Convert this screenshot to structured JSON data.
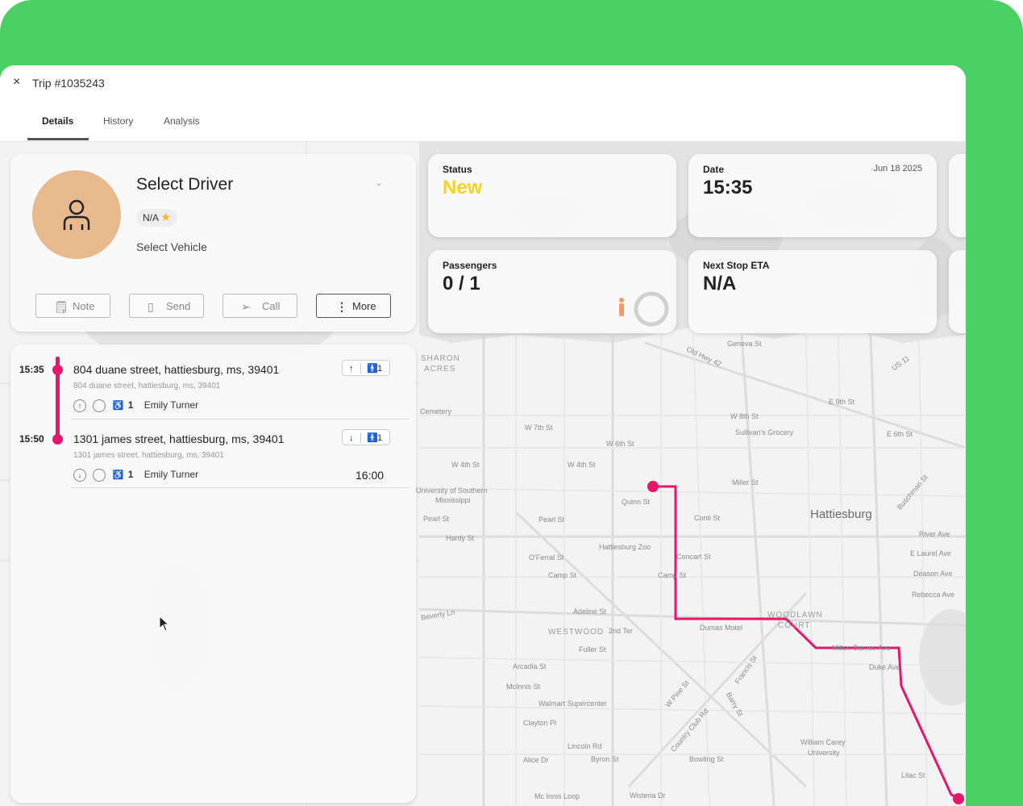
{
  "window": {
    "close_icon": "×",
    "title": "Trip #1035243"
  },
  "tabs": [
    {
      "label": "Details"
    },
    {
      "label": "History"
    },
    {
      "label": "Analysis"
    }
  ],
  "driver": {
    "name": "Select Driver",
    "rating": "N/A",
    "rating_star": "★",
    "vehicle": "Select Vehicle",
    "actions": {
      "note": "Note",
      "send": "Send",
      "call": "Call",
      "more": "More"
    }
  },
  "stats": {
    "status": {
      "title": "Status",
      "value": "New",
      "color": "#f5d320"
    },
    "date": {
      "title": "Date",
      "value": "15:35",
      "date": "Jun 18 2025"
    },
    "passengers": {
      "title": "Passengers",
      "value": "0 / 1"
    },
    "next_stop": {
      "title": "Next Stop ETA",
      "value": "N/A"
    }
  },
  "stops": [
    {
      "time": "15:35",
      "address": "804 duane street, hattiesburg, ms, 39401",
      "address_sub": "804 duane street, hattiesburg, ms, 39401",
      "direction": "↑",
      "count": "1",
      "passenger_count": "1",
      "passenger": "Emily Turner",
      "eta": ""
    },
    {
      "time": "15:50",
      "address": "1301 james street, hattiesburg, ms, 39401",
      "address_sub": "1301 james street, hattiesburg, ms, 39401",
      "direction": "↓",
      "count": "1",
      "passenger_count": "1",
      "passenger": "Emily Turner",
      "eta": "16:00"
    }
  ],
  "map": {
    "city": "Hattiesburg",
    "route_color": "#e5166c",
    "labels": {
      "l1": "SHARON",
      "l2": "ACRES",
      "l3": "Cemetery",
      "l4": "W 7th St",
      "l5": "W 4th St",
      "l6": "W 4th St",
      "l7": "W 6th St",
      "l8": "W 8th St",
      "l9": "Sullivan's Grocery",
      "l10": "Geneva St",
      "l11": "Old Hwy 42",
      "l12": "E 9th St",
      "l13": "E 6th St",
      "l14": "University of Southern",
      "l15": "Mississippi",
      "l16": "Pearl St",
      "l17": "Pearl St",
      "l18": "Hardy St",
      "l19": "Quinn St",
      "l20": "Miller St",
      "l21": "Conti St",
      "l22": "River Ave",
      "l23": "E Laurel Ave",
      "l24": "Deason Ave",
      "l25": "Rebecca Ave",
      "l26": "O'Ferral St",
      "l27": "Hattiesburg Zoo",
      "l28": "Concart St",
      "l29": "Camp St",
      "l30": "Camp St",
      "l31": "Beverly Ln",
      "l32": "WESTWOOD",
      "l33": "2nd Ter",
      "l34": "Adeline St",
      "l35": "Fuller St",
      "l36": "Dumas Motel",
      "l37": "WOODLAWN",
      "l38": "COURT",
      "l39": "Milton Barnes Ave",
      "l40": "Duke Ave",
      "l41": "Arcadia St",
      "l42": "McInnis St",
      "l43": "Walmart Supercenter",
      "l44": "Clayton Pl",
      "l45": "Lincoln Rd",
      "l46": "Alice Dr",
      "l47": "Byron St",
      "l48": "Bowling St",
      "l49": "William Carey",
      "l50": "University",
      "l51": "Lilac St",
      "l52": "Mc Innis Loop",
      "l53": "Wisteria Dr",
      "l54": "W Pine St",
      "l55": "Country Club Rd",
      "l56": "Barry St",
      "l57": "Francis St",
      "l58": "US 11",
      "l59": "Buschman St"
    }
  }
}
